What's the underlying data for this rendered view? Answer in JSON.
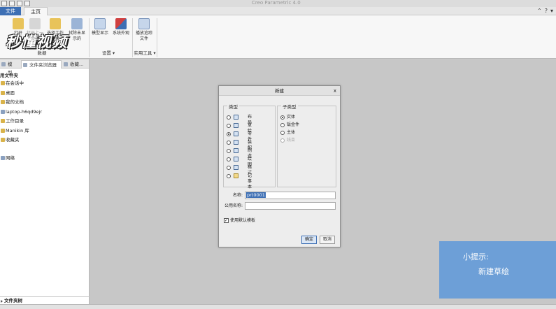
{
  "window": {
    "title": "Creo Parametric 4.0"
  },
  "ribbon": {
    "tabs": [
      "文件",
      "主页"
    ],
    "buttons": {
      "open": "打开",
      "open_last_1": "打开上一",
      "open_last_2": "会话",
      "select_dir_1": "选择工作",
      "select_dir_2": "目录",
      "erase_1": "拭除未显",
      "erase_2": "示的",
      "model_display": "模型显示",
      "system_appearance": "系统外观",
      "playback_1": "播放追踪",
      "playback_2": "文件"
    },
    "groups": {
      "data": "数据",
      "settings": "设置",
      "utilities": "实用工具"
    },
    "watermark": "秒懂视频"
  },
  "left_panel": {
    "tabs": [
      "模型...",
      "文件夹浏览器",
      "收藏..."
    ],
    "heading": "用文件夹",
    "folders": [
      "在会话中",
      "桌面",
      "我的文档",
      "laptop-h6qd9ejr",
      "工作目录",
      "Manikin 库",
      "收藏夹",
      "网络"
    ],
    "bottom": "文件夹树"
  },
  "dialog": {
    "title": "新建",
    "close": "x",
    "type_legend": "类型",
    "types": [
      "布局",
      "草绘",
      "零件",
      "装配",
      "制造",
      "绘图",
      "格式",
      "记事本"
    ],
    "type_selected": 2,
    "subtype_legend": "子类型",
    "subtypes": [
      "实体",
      "钣金件",
      "主体",
      "线束"
    ],
    "subtype_selected": 0,
    "name_label": "名称:",
    "name_value": "prt0001",
    "common_name_label": "公用名称:",
    "common_name_value": "",
    "use_template_label": "使用默认模板",
    "use_template_checked": true,
    "ok": "确定",
    "cancel": "取消"
  },
  "hint": {
    "title": "小提示:",
    "body": "新建草绘"
  },
  "colors": {
    "accent": "#3d6fb4",
    "hint_bg": "#6d9fd7"
  }
}
